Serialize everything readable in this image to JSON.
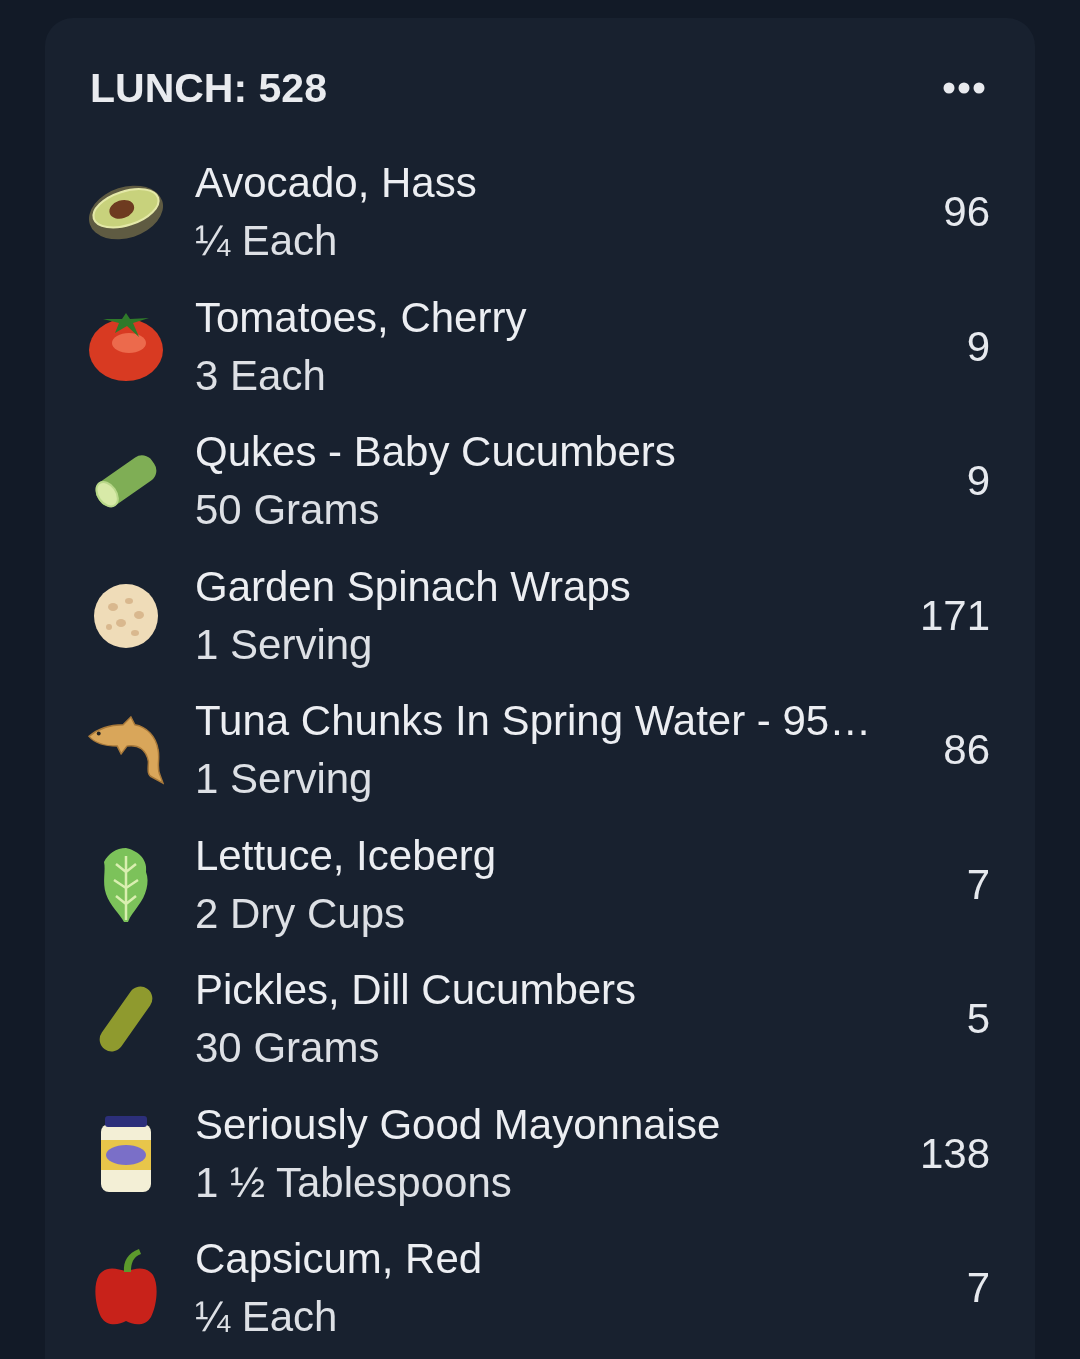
{
  "meal": {
    "title": "LUNCH: 528"
  },
  "items": [
    {
      "name": "Avocado, Hass",
      "quantity": "¼ Each",
      "calories": "96"
    },
    {
      "name": "Tomatoes, Cherry",
      "quantity": "3 Each",
      "calories": "9"
    },
    {
      "name": "Qukes - Baby Cucumbers",
      "quantity": "50 Grams",
      "calories": "9"
    },
    {
      "name": "Garden Spinach Wraps",
      "quantity": "1 Serving",
      "calories": "171"
    },
    {
      "name": "Tuna Chunks In Spring Water - 95…",
      "quantity": "1 Serving",
      "calories": "86"
    },
    {
      "name": "Lettuce, Iceberg",
      "quantity": "2 Dry Cups",
      "calories": "7"
    },
    {
      "name": "Pickles, Dill Cucumbers",
      "quantity": "30 Grams",
      "calories": "5"
    },
    {
      "name": "Seriously Good Mayonnaise",
      "quantity": "1 ½ Tablespoons",
      "calories": "138"
    },
    {
      "name": "Capsicum, Red",
      "quantity": "¼ Each",
      "calories": "7"
    }
  ]
}
